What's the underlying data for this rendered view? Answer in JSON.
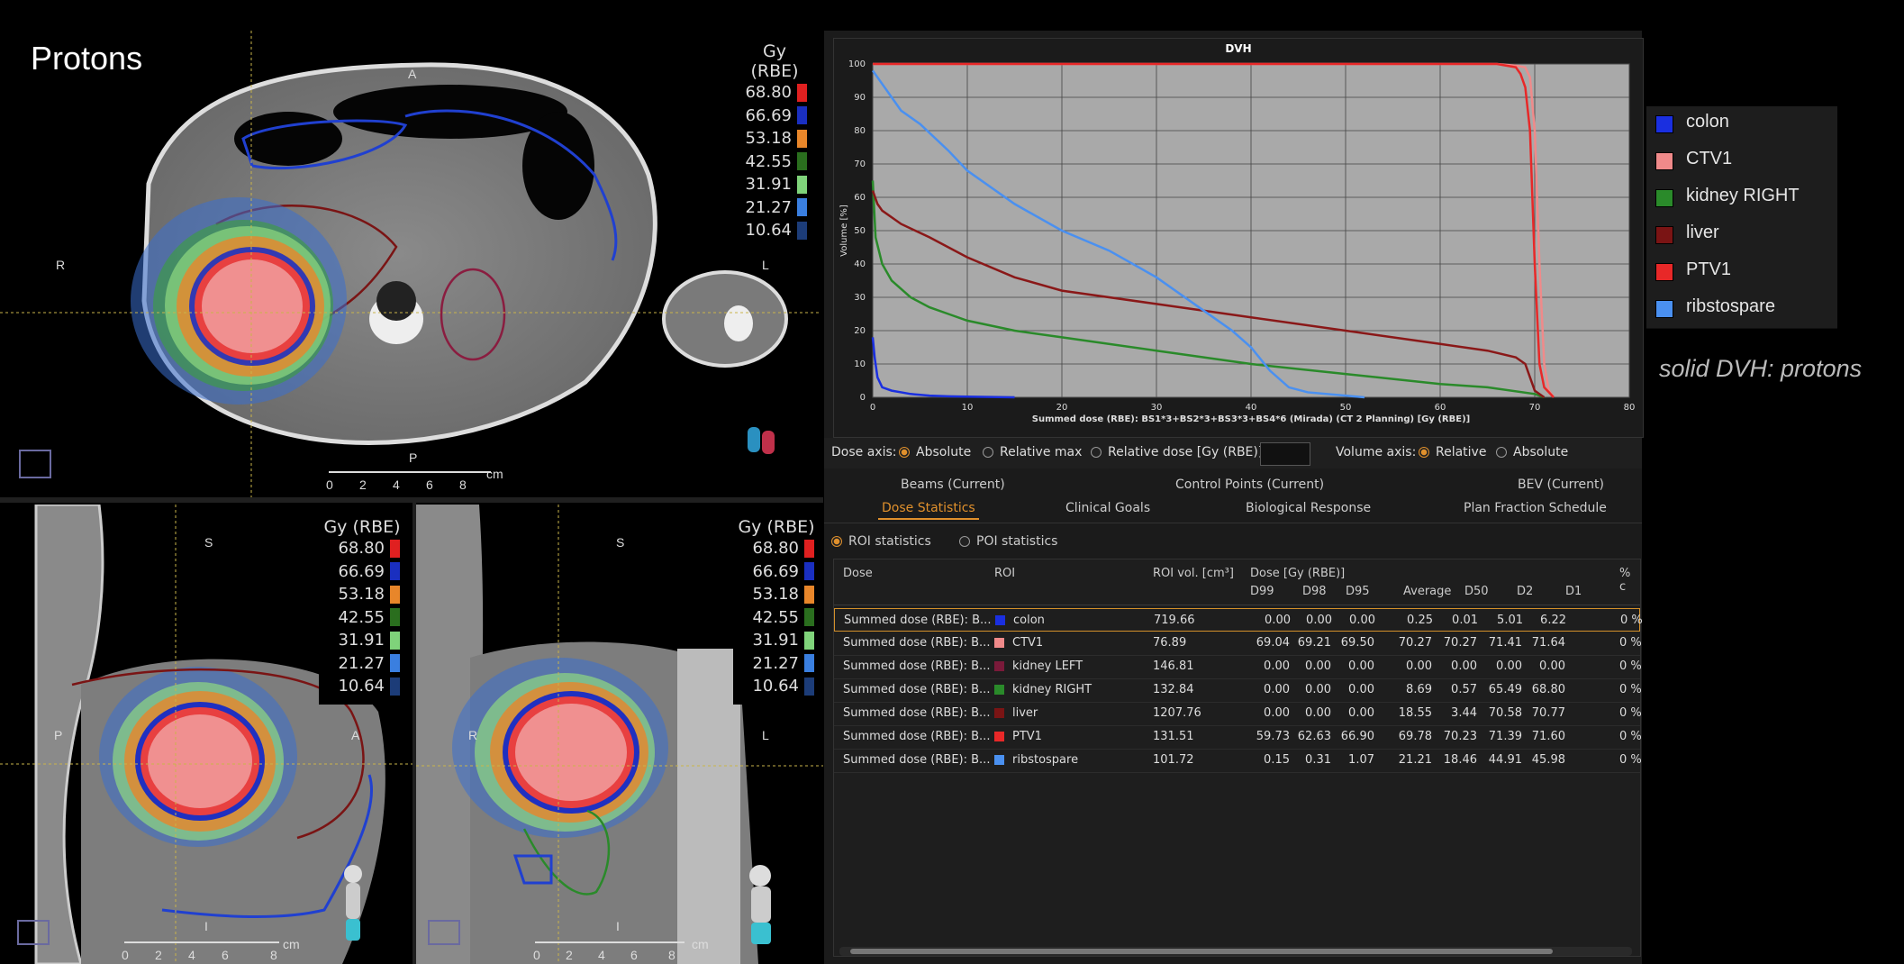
{
  "axial": {
    "title": "Protons",
    "orient_top": "A",
    "orient_left": "R",
    "orient_right": "L",
    "orient_bottom": "P",
    "scale_ticks": [
      "0",
      "2",
      "4",
      "6",
      "8"
    ],
    "scale_unit": "cm"
  },
  "sagittal": {
    "orient_top": "S",
    "orient_left": "P",
    "orient_right": "A",
    "orient_bottom": "I",
    "scale_ticks": [
      "0",
      "2",
      "4",
      "6",
      "8"
    ],
    "scale_unit": "cm"
  },
  "coronal": {
    "orient_top": "S",
    "orient_left": "R",
    "orient_right": "L",
    "orient_bottom": "I",
    "scale_ticks": [
      "0",
      "2",
      "4",
      "6",
      "8"
    ],
    "scale_unit": "cm"
  },
  "dose_legend": {
    "title": "Gy (RBE)",
    "levels": [
      {
        "value": "68.80",
        "color": "#e02020"
      },
      {
        "value": "66.69",
        "color": "#1a2fc0"
      },
      {
        "value": "53.18",
        "color": "#e8862a"
      },
      {
        "value": "42.55",
        "color": "#2a6e1e"
      },
      {
        "value": "31.91",
        "color": "#7fd37a"
      },
      {
        "value": "21.27",
        "color": "#3a7fe0"
      },
      {
        "value": "10.64",
        "color": "#1c3c78"
      }
    ]
  },
  "dvh": {
    "title": "DVH",
    "ylabel": "Volume [%]",
    "xlabel": "Summed dose (RBE): BS1*3+BS2*3+BS3*3+BS4*6 (Mirada) (CT 2 Planning) [Gy (RBE)]",
    "xticks": [
      "0",
      "10",
      "20",
      "30",
      "40",
      "50",
      "60",
      "70",
      "80"
    ],
    "yticks": [
      "0",
      "10",
      "20",
      "30",
      "40",
      "50",
      "60",
      "70",
      "80",
      "90",
      "100"
    ]
  },
  "chart_data": {
    "type": "line",
    "title": "DVH",
    "xlabel": "Summed dose (RBE): BS1*3+BS2*3+BS3*3+BS4*6 (Mirada) (CT 2 Planning) [Gy (RBE)]",
    "ylabel": "Volume [%]",
    "xlim": [
      0,
      80
    ],
    "ylim": [
      0,
      100
    ],
    "grid": true,
    "series": [
      {
        "name": "colon",
        "color": "#1a2fe0",
        "x": [
          0,
          0.2,
          0.5,
          1,
          2,
          3,
          4,
          6,
          8,
          10,
          15
        ],
        "y": [
          18,
          12,
          6,
          3,
          2,
          1.5,
          1,
          0.5,
          0.3,
          0.2,
          0
        ]
      },
      {
        "name": "CTV1",
        "color": "#f08a8a",
        "x": [
          0,
          60,
          66,
          68,
          69,
          69.5,
          70,
          70.5,
          71,
          71.5,
          72
        ],
        "y": [
          100,
          100,
          100,
          99.5,
          99,
          96,
          80,
          40,
          10,
          2,
          0
        ]
      },
      {
        "name": "kidney RIGHT",
        "color": "#2a8a2a",
        "x": [
          0,
          0.3,
          1,
          2,
          4,
          6,
          8,
          10,
          15,
          20,
          30,
          40,
          50,
          60,
          65,
          70,
          71
        ],
        "y": [
          65,
          48,
          40,
          35,
          30,
          27,
          25,
          23,
          20,
          18,
          14,
          10,
          7,
          4,
          3,
          1,
          0
        ]
      },
      {
        "name": "liver",
        "color": "#8a1818",
        "x": [
          0,
          0.5,
          1,
          3,
          6,
          10,
          15,
          20,
          30,
          40,
          50,
          60,
          65,
          68,
          69,
          69.5,
          70,
          71
        ],
        "y": [
          62,
          58,
          56,
          52,
          48,
          42,
          36,
          32,
          28,
          24,
          20,
          16,
          14,
          12,
          10,
          6,
          2,
          0
        ]
      },
      {
        "name": "PTV1",
        "color": "#e82828",
        "x": [
          0,
          60,
          66,
          68,
          68.5,
          69,
          69.5,
          70,
          70.5,
          71,
          72
        ],
        "y": [
          100,
          100,
          100,
          99,
          97,
          93,
          80,
          40,
          10,
          3,
          0
        ]
      },
      {
        "name": "ribstospare",
        "color": "#4a90f0",
        "x": [
          0,
          1,
          2,
          3,
          5,
          8,
          10,
          15,
          20,
          25,
          30,
          35,
          38,
          40,
          42,
          44,
          46,
          50,
          52
        ],
        "y": [
          98,
          94,
          90,
          86,
          82,
          74,
          68,
          58,
          50,
          44,
          36,
          26,
          20,
          15,
          8,
          3,
          1.5,
          0.5,
          0
        ]
      }
    ]
  },
  "dose_axis": {
    "label": "Dose axis:",
    "options": [
      "Absolute",
      "Relative max",
      "Relative dose [Gy (RBE)]:"
    ],
    "selected": "Absolute",
    "relative_value": "",
    "volume_label": "Volume axis:",
    "volume_options": [
      "Relative",
      "Absolute"
    ],
    "volume_selected": "Relative"
  },
  "tabs": {
    "row1": [
      "Beams (Current)",
      "Control Points (Current)",
      "BEV (Current)"
    ],
    "row2": [
      "Dose Statistics",
      "Clinical Goals",
      "Biological Response",
      "Plan Fraction Schedule"
    ],
    "active": "Dose Statistics"
  },
  "stats_mode": {
    "options": [
      "ROI statistics",
      "POI statistics"
    ],
    "selected": "ROI statistics"
  },
  "table": {
    "headers": {
      "dose": "Dose",
      "roi": "ROI",
      "roi_vol": "ROI vol. [cm³]",
      "dose_group": "Dose [Gy (RBE)]",
      "d99": "D99",
      "d98": "D98",
      "d95": "D95",
      "avg": "Average",
      "d50": "D50",
      "d2": "D2",
      "d1": "D1",
      "pct": "% c"
    },
    "rows": [
      {
        "dose": "Summed dose (RBE): B...",
        "roi": "colon",
        "color": "#1a2fe0",
        "vol": "719.66",
        "d99": "0.00",
        "d98": "0.00",
        "d95": "0.00",
        "avg": "0.25",
        "d50": "0.01",
        "d2": "5.01",
        "d1": "6.22",
        "pct": "0 %"
      },
      {
        "dose": "Summed dose (RBE): B...",
        "roi": "CTV1",
        "color": "#f08a8a",
        "vol": "76.89",
        "d99": "69.04",
        "d98": "69.21",
        "d95": "69.50",
        "avg": "70.27",
        "d50": "70.27",
        "d2": "71.41",
        "d1": "71.64",
        "pct": "0 %"
      },
      {
        "dose": "Summed dose (RBE): B...",
        "roi": "kidney LEFT",
        "color": "#7a1a3a",
        "vol": "146.81",
        "d99": "0.00",
        "d98": "0.00",
        "d95": "0.00",
        "avg": "0.00",
        "d50": "0.00",
        "d2": "0.00",
        "d1": "0.00",
        "pct": "0 %"
      },
      {
        "dose": "Summed dose (RBE): B...",
        "roi": "kidney RIGHT",
        "color": "#2a8a2a",
        "vol": "132.84",
        "d99": "0.00",
        "d98": "0.00",
        "d95": "0.00",
        "avg": "8.69",
        "d50": "0.57",
        "d2": "65.49",
        "d1": "68.80",
        "pct": "0 %"
      },
      {
        "dose": "Summed dose (RBE): B...",
        "roi": "liver",
        "color": "#7a1414",
        "vol": "1207.76",
        "d99": "0.00",
        "d98": "0.00",
        "d95": "0.00",
        "avg": "18.55",
        "d50": "3.44",
        "d2": "70.58",
        "d1": "70.77",
        "pct": "0 %"
      },
      {
        "dose": "Summed dose (RBE): B...",
        "roi": "PTV1",
        "color": "#e82828",
        "vol": "131.51",
        "d99": "59.73",
        "d98": "62.63",
        "d95": "66.90",
        "avg": "69.78",
        "d50": "70.23",
        "d2": "71.39",
        "d1": "71.60",
        "pct": "0 %"
      },
      {
        "dose": "Summed dose (RBE): B...",
        "roi": "ribstospare",
        "color": "#4a90f0",
        "vol": "101.72",
        "d99": "0.15",
        "d98": "0.31",
        "d95": "1.07",
        "avg": "21.21",
        "d50": "18.46",
        "d2": "44.91",
        "d1": "45.98",
        "pct": "0 %"
      }
    ]
  },
  "roi_legend": [
    {
      "label": "colon",
      "color": "#1a2fe0"
    },
    {
      "label": "CTV1",
      "color": "#f08a8a"
    },
    {
      "label": "kidney RIGHT",
      "color": "#2a8a2a"
    },
    {
      "label": "liver",
      "color": "#7a1414"
    },
    {
      "label": "PTV1",
      "color": "#e82828"
    },
    {
      "label": "ribstospare",
      "color": "#4a90f0"
    }
  ],
  "note": "solid DVH: protons"
}
